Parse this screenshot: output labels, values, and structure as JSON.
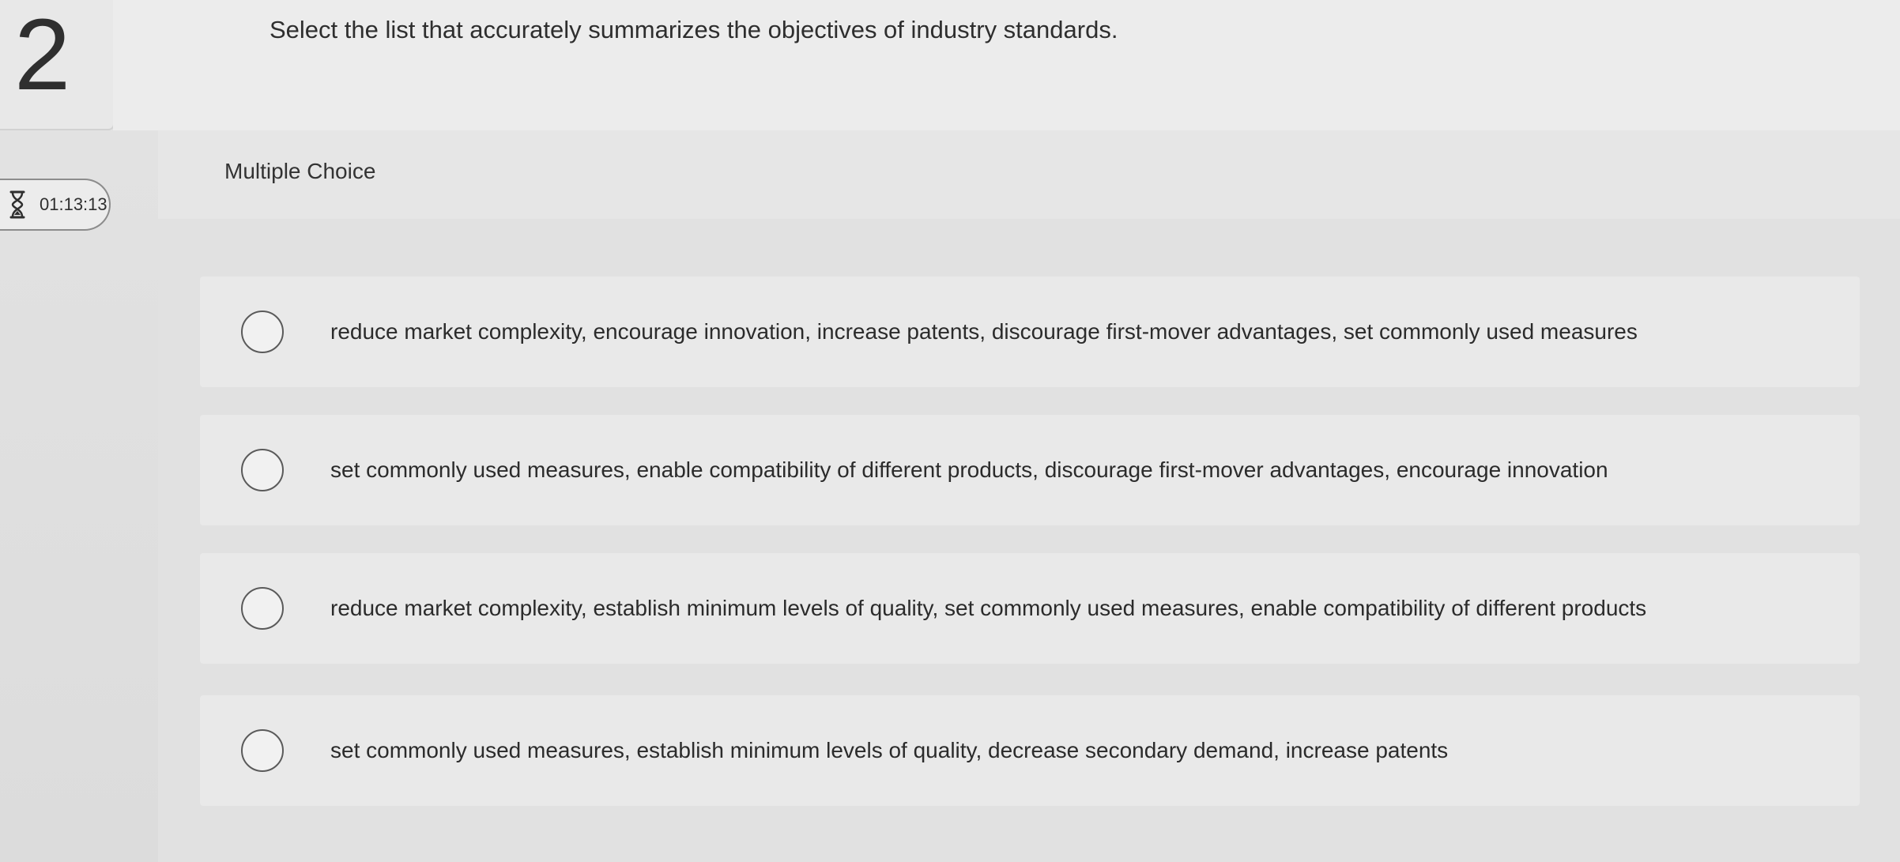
{
  "question": {
    "number": "2",
    "prompt": "Select the list that accurately summarizes the objectives of industry standards.",
    "type_label": "Multiple Choice"
  },
  "timer": {
    "icon": "hourglass-icon",
    "value": "01:13:13"
  },
  "options": [
    {
      "label": "reduce market complexity, encourage innovation, increase patents, discourage first-mover advantages, set commonly used measures",
      "selected": false
    },
    {
      "label": "set commonly used measures, enable compatibility of different products, discourage first-mover advantages, encourage innovation",
      "selected": false
    },
    {
      "label": "reduce market complexity, establish minimum levels of quality, set commonly used measures, enable compatibility of different products",
      "selected": false
    },
    {
      "label": "set commonly used measures, establish minimum levels of quality, decrease secondary demand, increase patents",
      "selected": false
    }
  ]
}
